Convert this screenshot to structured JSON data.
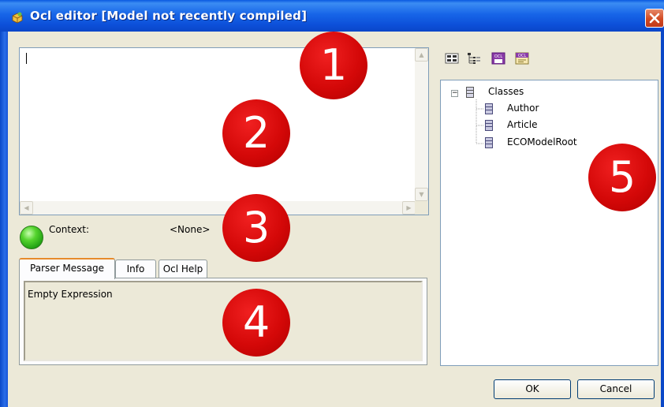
{
  "window": {
    "title": "Ocl editor [Model not recently compiled]",
    "close_symbol": "✕"
  },
  "editor": {
    "expression": ""
  },
  "context": {
    "label": "Context:",
    "value": "<None>",
    "status_color": "#33c21a"
  },
  "tabs": [
    {
      "label": "Parser Message",
      "active": true
    },
    {
      "label": "Info",
      "active": false
    },
    {
      "label": "Ocl Help",
      "active": false
    }
  ],
  "parser_message": "Empty Expression",
  "toolbar": {
    "icons": [
      "show-details-icon",
      "tree-view-icon",
      "ocl-evaluate-icon",
      "ocl-document-icon"
    ],
    "ocl_badge": "OCL"
  },
  "tree": {
    "root": {
      "label": "Classes",
      "expander": "−"
    },
    "children": [
      {
        "label": "Author"
      },
      {
        "label": "Article"
      },
      {
        "label": "ECOModelRoot"
      }
    ]
  },
  "buttons": {
    "ok": "OK",
    "cancel": "Cancel"
  },
  "callouts": [
    "1",
    "2",
    "3",
    "4",
    "5"
  ],
  "colors": {
    "accent_tab": "#e68b2c",
    "callout_red": "#d40808",
    "titlebar_blue": "#0c4fd8"
  }
}
